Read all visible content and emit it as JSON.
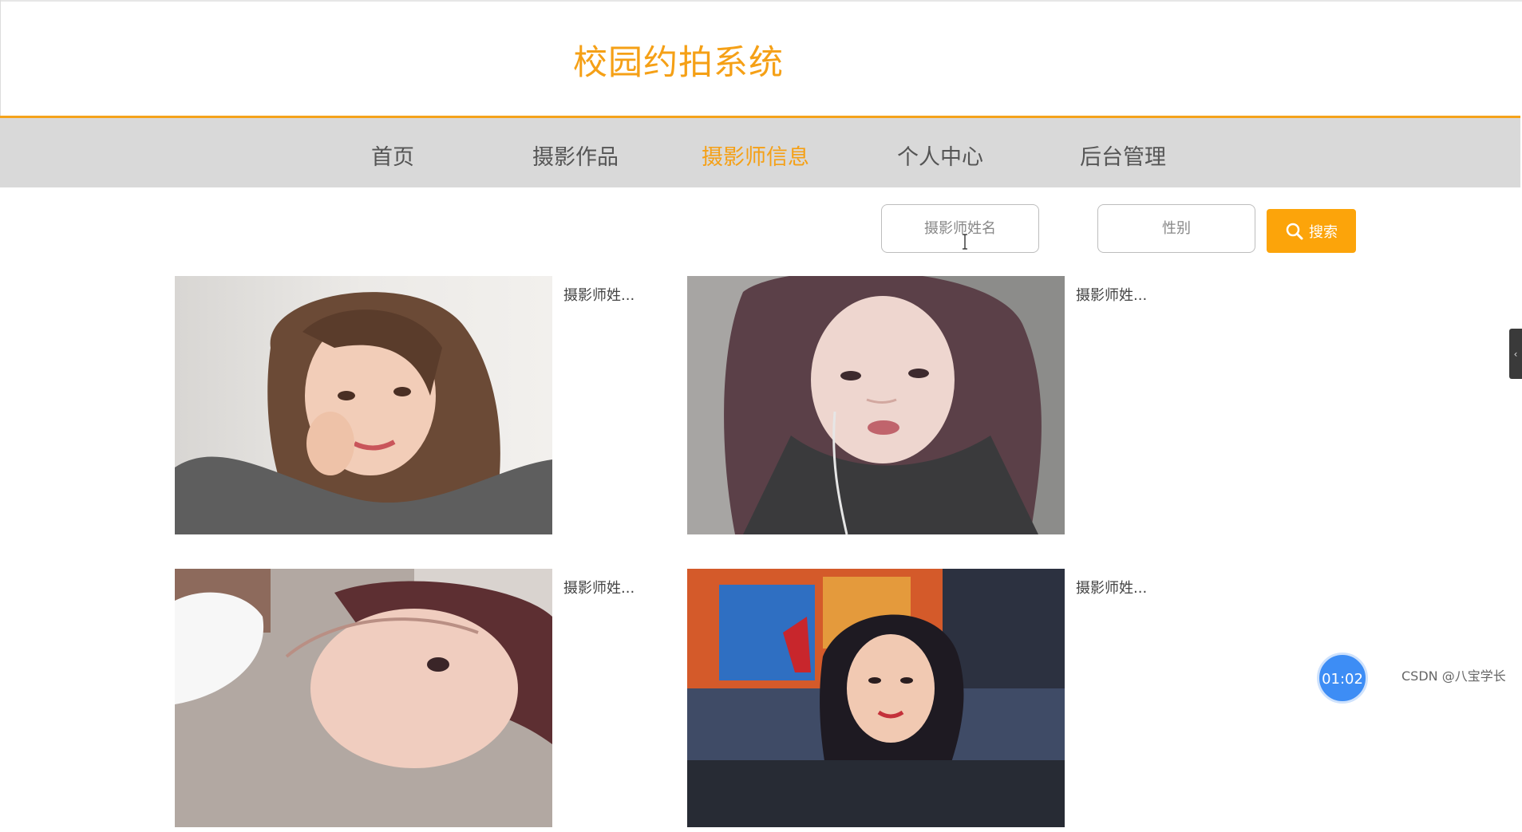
{
  "header": {
    "title": "校园约拍系统"
  },
  "nav": {
    "items": [
      {
        "label": "首页",
        "active": false
      },
      {
        "label": "摄影作品",
        "active": false
      },
      {
        "label": "摄影师信息",
        "active": true
      },
      {
        "label": "个人中心",
        "active": false
      },
      {
        "label": "后台管理",
        "active": false
      }
    ]
  },
  "search": {
    "name_placeholder": "摄影师姓名",
    "gender_placeholder": "性别",
    "button_label": "搜索"
  },
  "cards": [
    {
      "name": "摄影师姓..."
    },
    {
      "name": "摄影师姓..."
    },
    {
      "name": "摄影师姓..."
    },
    {
      "name": "摄影师姓..."
    }
  ],
  "overlay": {
    "timer": "01:02",
    "watermark": "CSDN @八宝学长"
  },
  "colors": {
    "accent": "#f5a016",
    "nav_bg": "#d9d9d9",
    "button": "#fca40a"
  },
  "icons": [
    "search-icon",
    "chevron-left-icon",
    "text-cursor-icon"
  ]
}
